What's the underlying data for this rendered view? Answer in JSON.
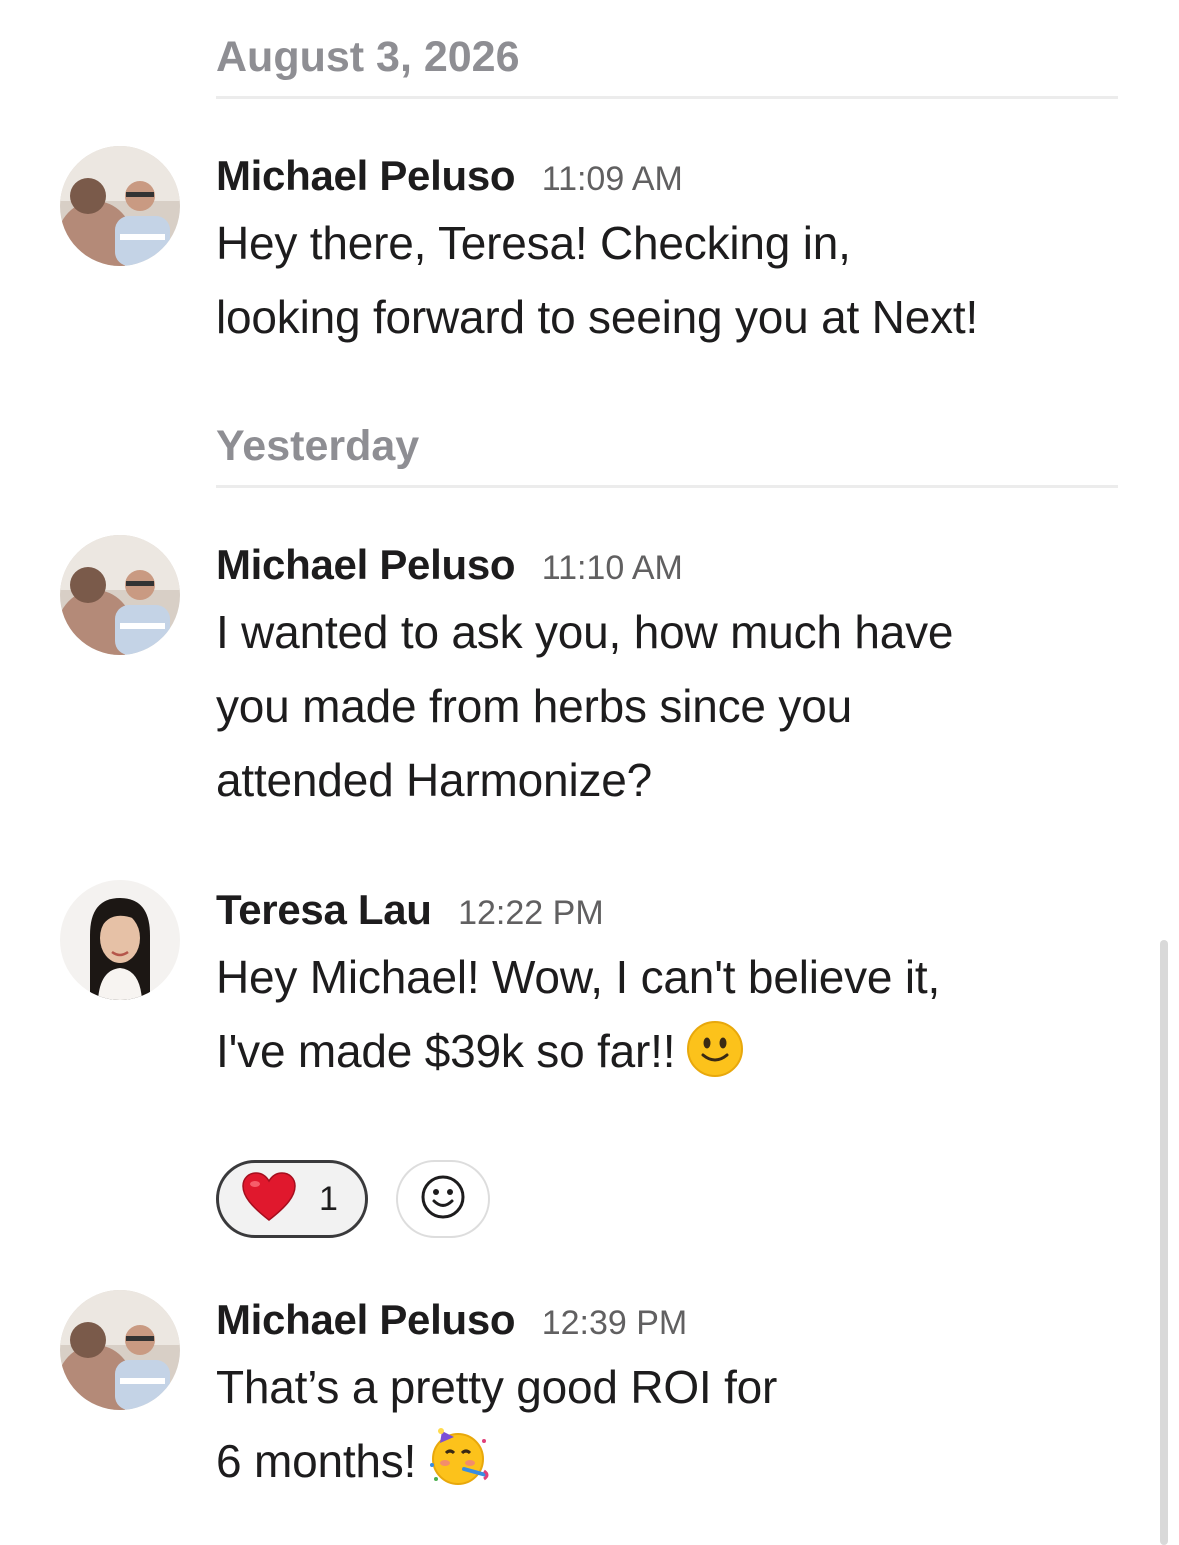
{
  "dividers": {
    "first": "August 3, 2026",
    "second": "Yesterday"
  },
  "messages": [
    {
      "sender": "Michael Peluso",
      "time": "11:09 AM",
      "lines": [
        "Hey there, Teresa! Checking in,",
        "looking forward to seeing you at Next!"
      ]
    },
    {
      "sender": "Michael Peluso",
      "time": "11:10 AM",
      "lines": [
        "I wanted to ask you, how much have",
        "you made from herbs since you",
        "attended Harmonize?"
      ]
    },
    {
      "sender": "Teresa Lau",
      "time": "12:22 PM",
      "lines": [
        "Hey Michael! Wow, I can't believe it,",
        "I've made $39k so far!!"
      ],
      "trailing_emoji": "slightly-smiling-face-emoji",
      "reactions": [
        {
          "emoji": "red-heart-emoji",
          "count": "1"
        }
      ]
    },
    {
      "sender": "Michael Peluso",
      "time": "12:39 PM",
      "lines": [
        "That’s a pretty good ROI for",
        "6 months!"
      ],
      "trailing_emoji": "partying-face-emoji"
    }
  ],
  "icons": {
    "add_reaction": "smiley-add-reaction-icon"
  },
  "colors": {
    "divider_text": "#8e8e93",
    "timestamp": "#616061",
    "text": "#1d1c1d",
    "reaction_border": "#3a3a3c"
  }
}
